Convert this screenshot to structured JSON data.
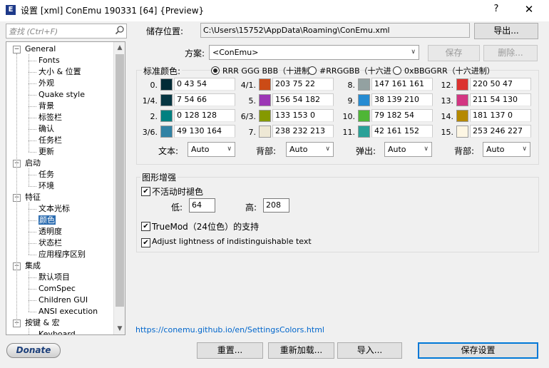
{
  "window": {
    "title": "设置 [xml] ConEmu 190331 [64] {Preview}",
    "app_icon_glyph": "E",
    "help_glyph": "?",
    "close_glyph": "✕"
  },
  "search": {
    "placeholder": "查找 (Ctrl+F)"
  },
  "tree": {
    "items": [
      {
        "label": "General",
        "level": 0,
        "toggle": "−"
      },
      {
        "label": "Fonts",
        "level": 1
      },
      {
        "label": "大小 & 位置",
        "level": 1
      },
      {
        "label": "外观",
        "level": 1
      },
      {
        "label": "Quake style",
        "level": 1
      },
      {
        "label": "背景",
        "level": 1
      },
      {
        "label": "标签栏",
        "level": 1
      },
      {
        "label": "确认",
        "level": 1
      },
      {
        "label": "任务栏",
        "level": 1
      },
      {
        "label": "更新",
        "level": 1
      },
      {
        "label": "启动",
        "level": 0,
        "toggle": "−"
      },
      {
        "label": "任务",
        "level": 1
      },
      {
        "label": "环境",
        "level": 1
      },
      {
        "label": "特征",
        "level": 0,
        "toggle": "−"
      },
      {
        "label": "文本光标",
        "level": 1
      },
      {
        "label": "颜色",
        "level": 1,
        "selected": true
      },
      {
        "label": "透明度",
        "level": 1
      },
      {
        "label": "状态栏",
        "level": 1
      },
      {
        "label": "应用程序区别",
        "level": 1
      },
      {
        "label": "集成",
        "level": 0,
        "toggle": "−"
      },
      {
        "label": "默认项目",
        "level": 1
      },
      {
        "label": "ComSpec",
        "level": 1
      },
      {
        "label": "Children GUI",
        "level": 1
      },
      {
        "label": "ANSI execution",
        "level": 1
      },
      {
        "label": "按键 & 宏",
        "level": 0,
        "toggle": "−"
      },
      {
        "label": "Keyboard",
        "level": 1
      }
    ]
  },
  "storage": {
    "label": "储存位置:",
    "path": "C:\\Users\\15752\\AppData\\Roaming\\ConEmu.xml",
    "export_label": "导出..."
  },
  "scheme": {
    "label": "方案:",
    "value": "<ConEmu>",
    "save_label": "保存",
    "delete_label": "删除..."
  },
  "std_colors": {
    "label": "标准颜色:",
    "format_options": [
      "RRR GGG BBB（十进制",
      "#RRGGBB（十六进",
      "0xBBGGRR（十六进制）"
    ],
    "selected_format": 0,
    "colors": [
      {
        "idx": "0.",
        "value": "0 43 54",
        "hex": "#002b36"
      },
      {
        "idx": "1/4.",
        "value": "7 54 66",
        "hex": "#073642"
      },
      {
        "idx": "2.",
        "value": "0 128 128",
        "hex": "#008080"
      },
      {
        "idx": "3/6.",
        "value": "49 130 164",
        "hex": "#3182a4"
      },
      {
        "idx": "4/1.",
        "value": "203 75 22",
        "hex": "#cb4b16"
      },
      {
        "idx": "5.",
        "value": "156 54 182",
        "hex": "#9c36b6"
      },
      {
        "idx": "6/3.",
        "value": "133 153 0",
        "hex": "#859900"
      },
      {
        "idx": "7.",
        "value": "238 232 213",
        "hex": "#eee8d5"
      },
      {
        "idx": "8.",
        "value": "147 161 161",
        "hex": "#93a1a1"
      },
      {
        "idx": "9.",
        "value": "38 139 210",
        "hex": "#268bd2"
      },
      {
        "idx": "10.",
        "value": "79 182 54",
        "hex": "#4fb636"
      },
      {
        "idx": "11.",
        "value": "42 161 152",
        "hex": "#2aa198"
      },
      {
        "idx": "12.",
        "value": "220 50 47",
        "hex": "#dc322f"
      },
      {
        "idx": "13.",
        "value": "211 54 130",
        "hex": "#d33682"
      },
      {
        "idx": "14.",
        "value": "181 137 0",
        "hex": "#b58900"
      },
      {
        "idx": "15.",
        "value": "253 246 227",
        "hex": "#fdf6e3"
      }
    ],
    "selectors": [
      {
        "label": "文本:",
        "value": "Auto"
      },
      {
        "label": "背部:",
        "value": "Auto"
      },
      {
        "label": "弹出:",
        "value": "Auto"
      },
      {
        "label": "背部:",
        "value": "Auto"
      }
    ]
  },
  "graphics": {
    "label": "图形增强",
    "fade_inactive_label": "不活动时褪色",
    "fade_inactive_checked": true,
    "low_label": "低:",
    "low_value": "64",
    "high_label": "高:",
    "high_value": "208",
    "truemod_label": "TrueMod（24位色）的支持",
    "truemod_checked": true,
    "adjust_label": "Adjust lightness of indistinguishable text",
    "adjust_checked": true
  },
  "link": {
    "text": "https://conemu.github.io/en/SettingsColors.html"
  },
  "footer": {
    "donate_label": "Donate",
    "reset_label": "重置...",
    "reload_label": "重新加载...",
    "import_label": "导入...",
    "save_settings_label": "保存设置"
  },
  "check_glyph": "✔",
  "dropdown_glyph": "∨"
}
